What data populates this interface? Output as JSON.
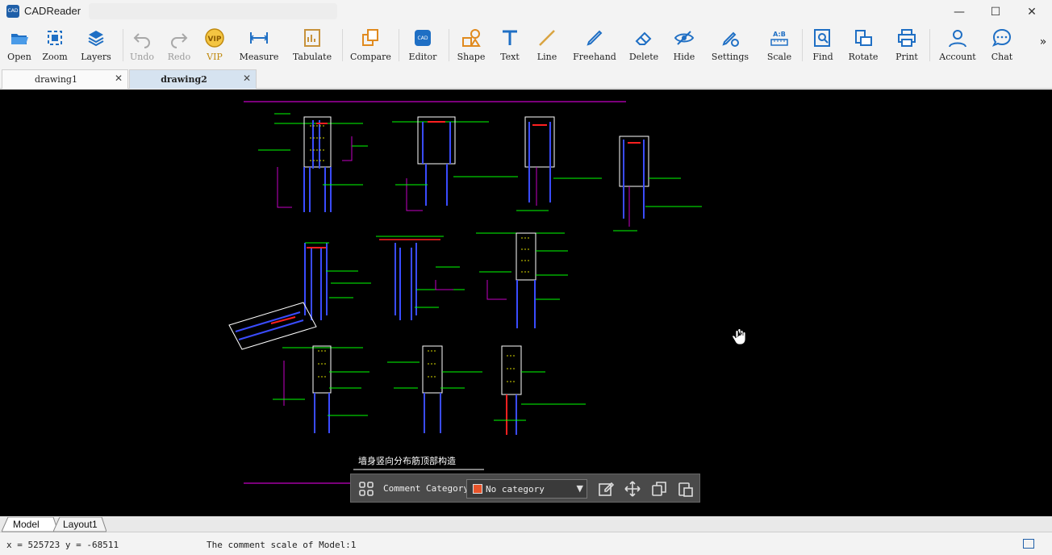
{
  "app": {
    "title": "CADReader",
    "icon_text": "CAD"
  },
  "window_controls": {
    "minimize": "—",
    "maximize": "☐",
    "close": "✕"
  },
  "toolbar": [
    {
      "label": "Open"
    },
    {
      "label": "Zoom"
    },
    {
      "label": "Layers"
    },
    {
      "label": "Undo"
    },
    {
      "label": "Redo"
    },
    {
      "label": "VIP"
    },
    {
      "label": "Measure"
    },
    {
      "label": "Tabulate"
    },
    {
      "label": "Compare"
    },
    {
      "label": "Editor"
    },
    {
      "label": "Shape"
    },
    {
      "label": "Text"
    },
    {
      "label": "Line"
    },
    {
      "label": "Freehand"
    },
    {
      "label": "Delete"
    },
    {
      "label": "Hide"
    },
    {
      "label": "Settings"
    },
    {
      "label": "Scale"
    },
    {
      "label": "Find"
    },
    {
      "label": "Rotate"
    },
    {
      "label": "Print"
    },
    {
      "label": "Account"
    },
    {
      "label": "Chat"
    }
  ],
  "toolbar_more": "»",
  "tabs": [
    {
      "label": "drawing1",
      "close": "✕"
    },
    {
      "label": "drawing2",
      "close": "✕"
    }
  ],
  "drawing": {
    "caption": "墙身竖向分布筋顶部构造"
  },
  "comment_toolbar": {
    "label": "Comment Category",
    "value": "No category",
    "arrow": "▼"
  },
  "layouts": [
    "Model",
    "Layout1"
  ],
  "status": {
    "coords": "x = 525723 y = -68511",
    "message": "The comment scale of Model:1"
  },
  "colors": {
    "accent": "#1f5fa8",
    "cad_bg": "#000000",
    "cad_green": "#00ff00",
    "cad_blue": "#3a4cff",
    "cad_magenta": "#c400c4",
    "cad_white": "#ffffff"
  }
}
